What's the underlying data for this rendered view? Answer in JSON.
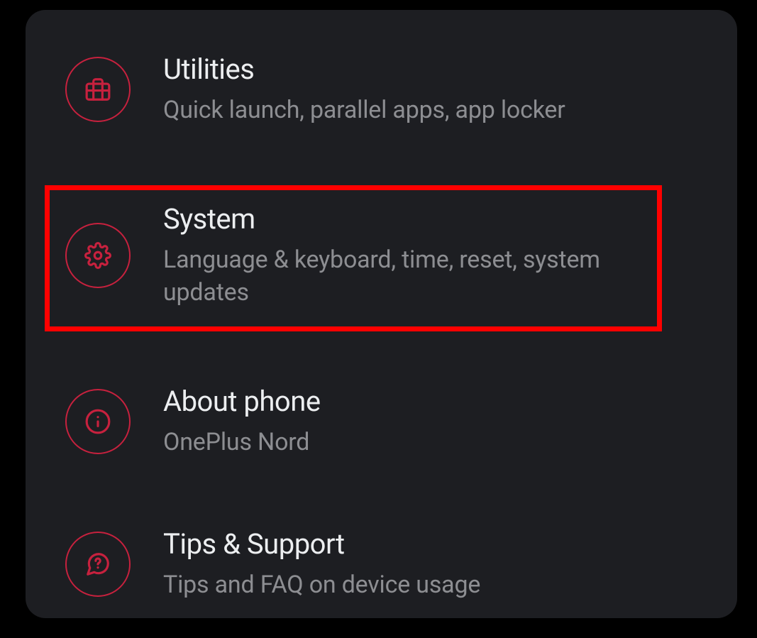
{
  "settings": {
    "items": [
      {
        "icon": "briefcase-icon",
        "title": "Utilities",
        "subtitle": "Quick launch, parallel apps, app locker"
      },
      {
        "icon": "gear-icon",
        "title": "System",
        "subtitle": "Language & keyboard, time, reset, system updates"
      },
      {
        "icon": "info-icon",
        "title": "About phone",
        "subtitle": "OnePlus Nord"
      },
      {
        "icon": "help-icon",
        "title": "Tips & Support",
        "subtitle": "Tips and FAQ on device usage"
      }
    ]
  },
  "highlight": {
    "target": "system"
  },
  "colors": {
    "accent": "#c7213e",
    "background": "#1d1e22",
    "title": "#eceef0",
    "subtitle": "#8d8e92",
    "highlight": "#ff0000"
  }
}
